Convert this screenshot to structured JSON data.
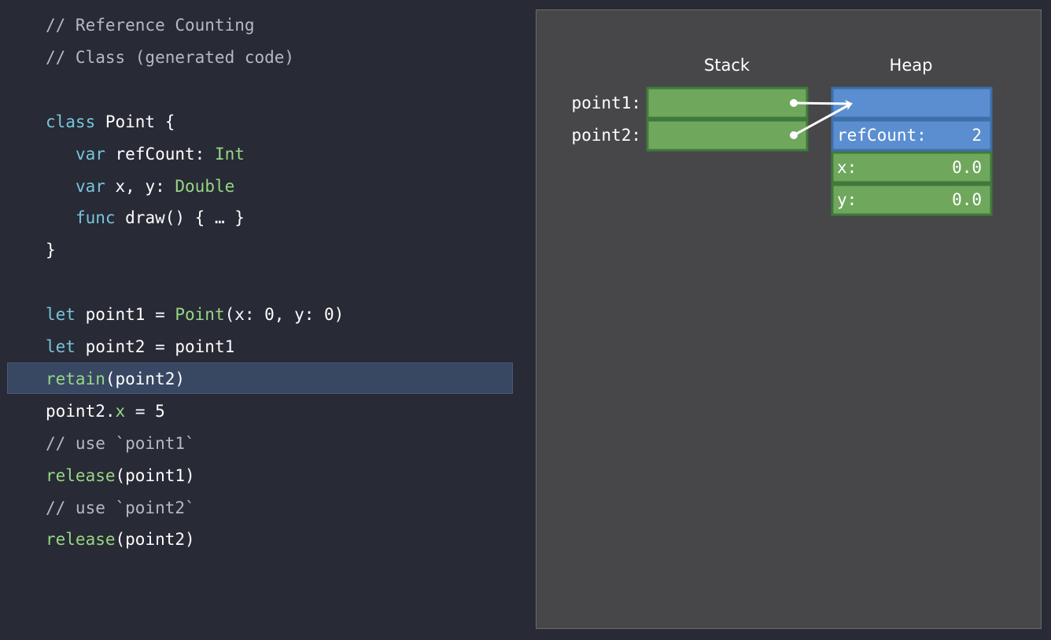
{
  "colors": {
    "background": "#282a35",
    "highlight": "#384863",
    "comment": "#b8b9bf",
    "keyword": "#77c5dc",
    "type": "#97d685",
    "panel": "#474749",
    "stack_cell": "#6fa75d",
    "stack_border": "#3f7a3c",
    "heap_header": "#5b8ed0",
    "heap_border": "#3e6fa8"
  },
  "code": {
    "lines": [
      {
        "tokens": [
          {
            "t": "// Reference Counting",
            "c": "comment"
          }
        ]
      },
      {
        "tokens": [
          {
            "t": "// Class (generated code)",
            "c": "comment"
          }
        ]
      },
      {
        "tokens": []
      },
      {
        "tokens": [
          {
            "t": "class",
            "c": "keyword"
          },
          {
            "t": " Point {",
            "c": "plain"
          }
        ]
      },
      {
        "tokens": [
          {
            "t": "   ",
            "c": "plain"
          },
          {
            "t": "var",
            "c": "keyword"
          },
          {
            "t": " refCount: ",
            "c": "plain"
          },
          {
            "t": "Int",
            "c": "type"
          }
        ]
      },
      {
        "tokens": [
          {
            "t": "   ",
            "c": "plain"
          },
          {
            "t": "var",
            "c": "keyword"
          },
          {
            "t": " x, y: ",
            "c": "plain"
          },
          {
            "t": "Double",
            "c": "type"
          }
        ]
      },
      {
        "tokens": [
          {
            "t": "   ",
            "c": "plain"
          },
          {
            "t": "func",
            "c": "keyword"
          },
          {
            "t": " draw() { … }",
            "c": "plain"
          }
        ]
      },
      {
        "tokens": [
          {
            "t": "}",
            "c": "plain"
          }
        ]
      },
      {
        "tokens": []
      },
      {
        "tokens": [
          {
            "t": "let",
            "c": "keyword"
          },
          {
            "t": " point1 = ",
            "c": "plain"
          },
          {
            "t": "Point",
            "c": "type"
          },
          {
            "t": "(x: 0, y: 0)",
            "c": "plain"
          }
        ]
      },
      {
        "tokens": [
          {
            "t": "let",
            "c": "keyword"
          },
          {
            "t": " point2 = point1",
            "c": "plain"
          }
        ]
      },
      {
        "tokens": [
          {
            "t": "retain",
            "c": "type"
          },
          {
            "t": "(point2)",
            "c": "plain"
          }
        ],
        "highlighted": true
      },
      {
        "tokens": [
          {
            "t": "point2.",
            "c": "plain"
          },
          {
            "t": "x",
            "c": "type"
          },
          {
            "t": " = 5",
            "c": "plain"
          }
        ]
      },
      {
        "tokens": [
          {
            "t": "// use `point1`",
            "c": "comment"
          }
        ]
      },
      {
        "tokens": [
          {
            "t": "release",
            "c": "type"
          },
          {
            "t": "(point1)",
            "c": "plain"
          }
        ]
      },
      {
        "tokens": [
          {
            "t": "// use `point2`",
            "c": "comment"
          }
        ]
      },
      {
        "tokens": [
          {
            "t": "release",
            "c": "type"
          },
          {
            "t": "(point2)",
            "c": "plain"
          }
        ]
      }
    ]
  },
  "diagram": {
    "stack_heading": "Stack",
    "heap_heading": "Heap",
    "stack_vars": [
      {
        "label": "point1:"
      },
      {
        "label": "point2:"
      }
    ],
    "heap_fields": [
      {
        "label": "",
        "value": "",
        "kind": "header"
      },
      {
        "label": "refCount:",
        "value": "2",
        "kind": "header"
      },
      {
        "label": "x:",
        "value": "0.0",
        "kind": "field"
      },
      {
        "label": "y:",
        "value": "0.0",
        "kind": "field"
      }
    ]
  }
}
